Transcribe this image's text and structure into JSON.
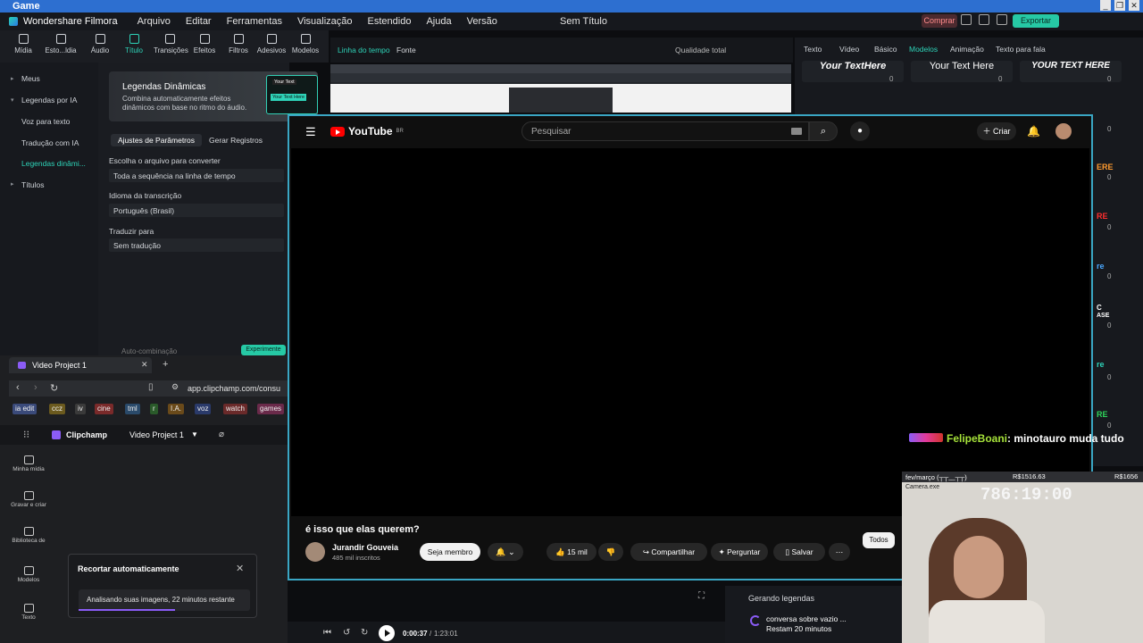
{
  "window": {
    "title": "Game",
    "controls": [
      "_",
      "❐",
      "✕"
    ]
  },
  "filmora": {
    "app_name": "Wondershare Filmora",
    "menu": [
      "Arquivo",
      "Editar",
      "Ferramentas",
      "Visualização",
      "Estendido",
      "Ajuda",
      "Versão"
    ],
    "doc_title": "Sem Título",
    "buy_label": "Comprar",
    "export_label": "Exportar",
    "toolbar": [
      {
        "label": "Mídia",
        "icon": "media-icon"
      },
      {
        "label": "Esto...ldia",
        "icon": "stock-icon"
      },
      {
        "label": "Áudio",
        "icon": "audio-icon"
      },
      {
        "label": "Título",
        "icon": "title-icon"
      },
      {
        "label": "Transições",
        "icon": "transitions-icon"
      },
      {
        "label": "Efeitos",
        "icon": "effects-icon"
      },
      {
        "label": "Filtros",
        "icon": "filters-icon"
      },
      {
        "label": "Adesivos",
        "icon": "stickers-icon"
      },
      {
        "label": "Modelos",
        "icon": "templates-icon"
      }
    ],
    "sidebar": [
      "Meus",
      "Legendas por IA",
      "Voz para texto",
      "Tradução com IA",
      "Legendas dinâmi...",
      "Títulos"
    ],
    "banner": {
      "title": "Legendas Dinâmicas",
      "desc": "Combina automaticamente efeitos dinâmicos com base no ritmo do áudio.",
      "thumb_top": "Your Text",
      "thumb_bottom": "Your Text Here"
    },
    "panel_tabs": [
      "Ajustes de Parâmetros",
      "Gerar Registros"
    ],
    "fields": [
      {
        "label": "Escolha o arquivo para converter",
        "value": "Toda a sequência na linha de tempo"
      },
      {
        "label": "Idioma da transcrição",
        "value": "Português (Brasil)"
      },
      {
        "label": "Traduzir para",
        "value": "Sem tradução"
      }
    ],
    "auto_text": "Auto-combinação",
    "auto_btn": "Experimente",
    "preview_tabs": [
      "Linha do tempo",
      "Fonte"
    ],
    "quality": "Qualidade total",
    "right_tabs": [
      "Texto",
      "Vídeo",
      "Básico",
      "Modelos",
      "Animação",
      "Texto para fala"
    ],
    "templates": [
      {
        "text": "Your TextHere",
        "count": "0"
      },
      {
        "text": "Your Text Here",
        "count": "0"
      },
      {
        "text": "YOUR TEXT HERE",
        "count": "0"
      }
    ],
    "right_edge_labels": [
      "ERE",
      "RE",
      "re",
      "C",
      "ASE",
      "re",
      "RE"
    ],
    "right_edge_counts": [
      "0",
      "0",
      "0",
      "0",
      "0",
      "0",
      "0",
      "0",
      "0",
      "0",
      "0"
    ],
    "generating": {
      "title": "Gerando legendas",
      "name": "conversa sobre vazio ...",
      "time": "Restam 20 minutos"
    },
    "time_current": "0:00:37",
    "time_total": "1:23:01"
  },
  "youtube": {
    "logo": "YouTube",
    "region": "BR",
    "search_placeholder": "Pesquisar",
    "create_label": "Criar",
    "video_title": "é isso que elas querem?",
    "channel": "Jurandir Gouveia",
    "subs": "485 mil inscritos",
    "member_btn": "Seja membro",
    "likes": "15 mil",
    "share": "Compartilhar",
    "ask": "Perguntar",
    "save": "Salvar",
    "filter_all": "Todos"
  },
  "chat": {
    "user": "FelipeBoani",
    "message": ": minotauro muda tudo"
  },
  "webcam": {
    "header": "fev/março (┬┬﹏┬┬)",
    "amount": "R$1516.63",
    "amount2": "R$1656",
    "sub": "Camera.exe",
    "clock": "786:19:00"
  },
  "browser": {
    "tab_title": "Video Project 1",
    "url": "app.clipchamp.com/consu",
    "bookmarks": [
      {
        "label": "ia edit",
        "color": "#3a4a7a"
      },
      {
        "label": "ccz",
        "color": "#6b5a1e"
      },
      {
        "label": "iv",
        "color": "#3a3a3a"
      },
      {
        "label": "cine",
        "color": "#7a2a2a"
      },
      {
        "label": "tml",
        "color": "#2a4a6a"
      },
      {
        "label": "r",
        "color": "#2a5a2a"
      },
      {
        "label": "I.A.",
        "color": "#6a4a1a"
      },
      {
        "label": "voz",
        "color": "#2a3a6a"
      },
      {
        "label": "watch",
        "color": "#6a2a2a"
      },
      {
        "label": "games",
        "color": "#6a2a4a"
      }
    ],
    "clip_app": "Clipchamp",
    "clip_project": "Video Project 1",
    "clip_side": [
      "Minha mídia",
      "Gravar e criar",
      "Biblioteca de",
      "Modelos",
      "Texto"
    ],
    "toast_title": "Recortar automaticamente",
    "toast_status": "Analisando suas imagens, 22 minutos restante"
  }
}
